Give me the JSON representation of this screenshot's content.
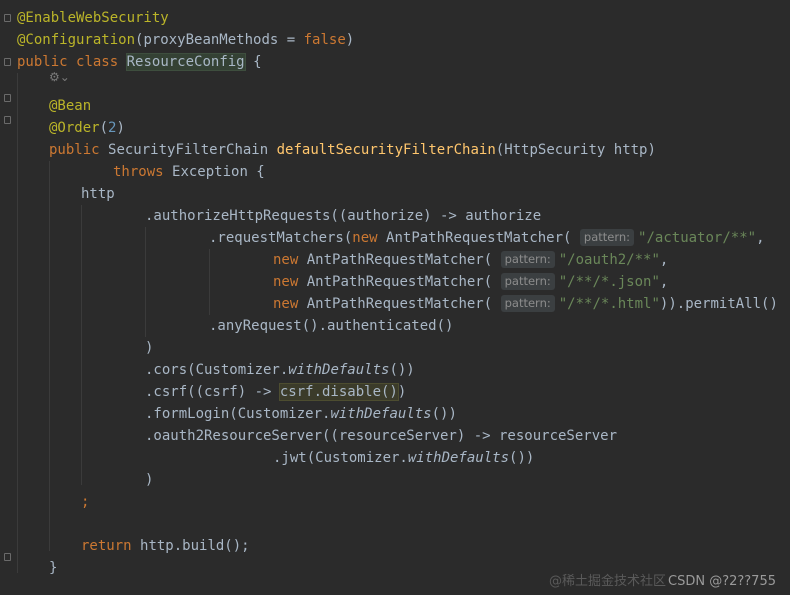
{
  "code": {
    "l1_ann": "@EnableWebSecurity",
    "l2_ann": "@Configuration",
    "l2_open": "(",
    "l2_param": "proxyBeanMethods = ",
    "l2_val": "false",
    "l2_close": ")",
    "l3_kw1": "public",
    "l3_kw2": "class",
    "l3_class": "ResourceConfig",
    "l3_brace": "{",
    "l5_ann": "@Bean",
    "l6_ann": "@Order",
    "l6_open": "(",
    "l6_num": "2",
    "l6_close": ")",
    "l7_kw": "public",
    "l7_type": "SecurityFilterChain",
    "l7_fn": "defaultSecurityFilterChain",
    "l7_params": "(HttpSecurity http)",
    "l8_kw": "throws",
    "l8_rest": "Exception {",
    "l9": "http",
    "l10": ".authorizeHttpRequests((authorize) -> authorize",
    "l11_pre": ".requestMatchers(",
    "new_kw": "new",
    "matcher": "AntPathRequestMatcher(",
    "hint": "pattern:",
    "l11_str": "\"/actuator/**\"",
    "comma": ",",
    "l12_str": "\"/oauth2/**\"",
    "l13_str": "\"/**/*.json\"",
    "l14_str": "\"/**/*.html\"",
    "l14_tail": ")).permitAll()",
    "l15": ".anyRequest().authenticated()",
    "close_paren": ")",
    "l17_pre": ".cors(Customizer.",
    "with_defaults": "withDefaults",
    "l17_post": "())",
    "l18_pre": ".csrf((csrf) -> ",
    "l18_hl": "csrf.disable()",
    "l18_post": ")",
    "l19_pre": ".formLogin(Customizer.",
    "l19_post": "())",
    "l20": ".oauth2ResourceServer((resourceServer) -> resourceServer",
    "l21_pre": ".jwt(Customizer.",
    "l21_post": "())",
    "semicolon": ";",
    "l25_kw": "return",
    "l25_rest": "http.build();",
    "l26": "}"
  },
  "gutter_icon": "settings-gear-icon",
  "watermark": {
    "cn_text": "@稀土掘金技术社区",
    "text": "CSDN @?2??755"
  },
  "colors": {
    "background": "#2b2b2b",
    "annotation": "#bbb529",
    "keyword": "#cc7832",
    "string": "#6a8759",
    "number": "#6897bb",
    "function": "#ffc66d",
    "text": "#a9b7c6"
  }
}
